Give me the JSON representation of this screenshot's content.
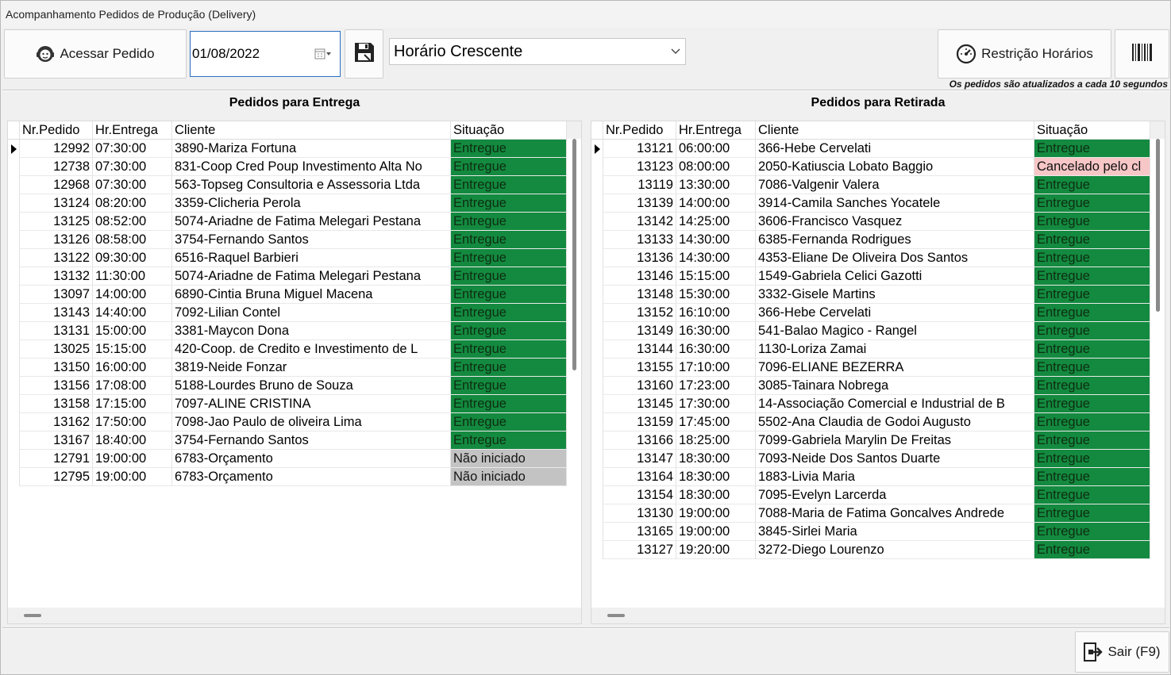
{
  "window": {
    "title": "Acompanhamento Pedidos de Produção (Delivery)"
  },
  "toolbar": {
    "access_label": "Acessar Pedido",
    "date_value": "01/08/2022",
    "sort_value": "Horário Crescente",
    "restriction_label": "Restrição Horários",
    "info_text": "Os pedidos são atualizados a cada 10 segundos"
  },
  "left": {
    "title": "Pedidos para Entrega",
    "columns": [
      "Nr.Pedido",
      "Hr.Entrega",
      "Cliente",
      "Situação"
    ],
    "rows": [
      [
        "12992",
        "07:30:00",
        "3890-Mariza Fortuna",
        "Entregue"
      ],
      [
        "12738",
        "07:30:00",
        "831-Coop Cred Poup Investimento Alta No",
        "Entregue"
      ],
      [
        "12968",
        "07:30:00",
        "563-Topseg Consultoria e Assessoria Ltda",
        "Entregue"
      ],
      [
        "13124",
        "08:20:00",
        "3359-Clicheria Perola",
        "Entregue"
      ],
      [
        "13125",
        "08:52:00",
        "5074-Ariadne de Fatima Melegari Pestana",
        "Entregue"
      ],
      [
        "13126",
        "08:58:00",
        "3754-Fernando Santos",
        "Entregue"
      ],
      [
        "13122",
        "09:30:00",
        "6516-Raquel Barbieri",
        "Entregue"
      ],
      [
        "13132",
        "11:30:00",
        "5074-Ariadne de Fatima Melegari Pestana",
        "Entregue"
      ],
      [
        "13097",
        "14:00:00",
        "6890-Cintia Bruna Miguel Macena",
        "Entregue"
      ],
      [
        "13143",
        "14:40:00",
        "7092-Lilian Contel",
        "Entregue"
      ],
      [
        "13131",
        "15:00:00",
        "3381-Maycon Dona",
        "Entregue"
      ],
      [
        "13025",
        "15:15:00",
        "420-Coop. de Credito e Investimento de L",
        "Entregue"
      ],
      [
        "13150",
        "16:00:00",
        "3819-Neide Fonzar",
        "Entregue"
      ],
      [
        "13156",
        "17:08:00",
        "5188-Lourdes Bruno de Souza",
        "Entregue"
      ],
      [
        "13158",
        "17:15:00",
        "7097-ALINE CRISTINA",
        "Entregue"
      ],
      [
        "13162",
        "17:50:00",
        "7098-Jao Paulo de oliveira Lima",
        "Entregue"
      ],
      [
        "13167",
        "18:40:00",
        "3754-Fernando Santos",
        "Entregue"
      ],
      [
        "12791",
        "19:00:00",
        "6783-Orçamento",
        "Não iniciado"
      ],
      [
        "12795",
        "19:00:00",
        "6783-Orçamento",
        "Não iniciado"
      ]
    ]
  },
  "right": {
    "title": "Pedidos para Retirada",
    "columns": [
      "Nr.Pedido",
      "Hr.Entrega",
      "Cliente",
      "Situação"
    ],
    "rows": [
      [
        "13121",
        "06:00:00",
        "366-Hebe Cervelati",
        "Entregue"
      ],
      [
        "13123",
        "08:00:00",
        "2050-Katiuscia Lobato Baggio",
        "Cancelado pelo cl"
      ],
      [
        "13119",
        "13:30:00",
        "7086-Valgenir Valera",
        "Entregue"
      ],
      [
        "13139",
        "14:00:00",
        "3914-Camila Sanches Yocatele",
        "Entregue"
      ],
      [
        "13142",
        "14:25:00",
        "3606-Francisco Vasquez",
        "Entregue"
      ],
      [
        "13133",
        "14:30:00",
        "6385-Fernanda Rodrigues",
        "Entregue"
      ],
      [
        "13136",
        "14:30:00",
        "4353-Eliane De Oliveira Dos Santos",
        "Entregue"
      ],
      [
        "13146",
        "15:15:00",
        "1549-Gabriela Celici Gazotti",
        "Entregue"
      ],
      [
        "13148",
        "15:30:00",
        "3332-Gisele Martins",
        "Entregue"
      ],
      [
        "13152",
        "16:10:00",
        "366-Hebe Cervelati",
        "Entregue"
      ],
      [
        "13149",
        "16:30:00",
        "541-Balao Magico - Rangel",
        "Entregue"
      ],
      [
        "13144",
        "16:30:00",
        "1130-Loriza Zamai",
        "Entregue"
      ],
      [
        "13155",
        "17:10:00",
        "7096-ELIANE BEZERRA",
        "Entregue"
      ],
      [
        "13160",
        "17:23:00",
        "3085-Tainara Nobrega",
        "Entregue"
      ],
      [
        "13145",
        "17:30:00",
        "14-Associação Comercial e Industrial de B",
        "Entregue"
      ],
      [
        "13159",
        "17:45:00",
        "5502-Ana Claudia de Godoi Augusto",
        "Entregue"
      ],
      [
        "13166",
        "18:25:00",
        "7099-Gabriela Marylin De Freitas",
        "Entregue"
      ],
      [
        "13147",
        "18:30:00",
        "7093-Neide Dos Santos Duarte",
        "Entregue"
      ],
      [
        "13164",
        "18:30:00",
        "1883-Livia Maria",
        "Entregue"
      ],
      [
        "13154",
        "18:30:00",
        "7095-Evelyn Larcerda",
        "Entregue"
      ],
      [
        "13130",
        "19:00:00",
        "7088-Maria de Fatima Goncalves Andrede",
        "Entregue"
      ],
      [
        "13165",
        "19:00:00",
        "3845-Sirlei Maria",
        "Entregue"
      ],
      [
        "13127",
        "19:20:00",
        "3272-Diego Lourenzo",
        "Entregue"
      ]
    ]
  },
  "footer": {
    "exit_label": "Sair (F9)"
  },
  "colors": {
    "entregue": "#138a3f",
    "nao_iniciado": "#c3c3c3",
    "cancelado": "#f7c6c6",
    "accent_border": "#2b6dc2"
  },
  "icons": [
    "support-agent-icon",
    "calendar-icon",
    "dropdown-arrow-icon",
    "save-disk-icon",
    "chevron-down-icon",
    "gauge-icon",
    "barcode-icon",
    "row-pointer-icon",
    "exit-door-icon"
  ]
}
